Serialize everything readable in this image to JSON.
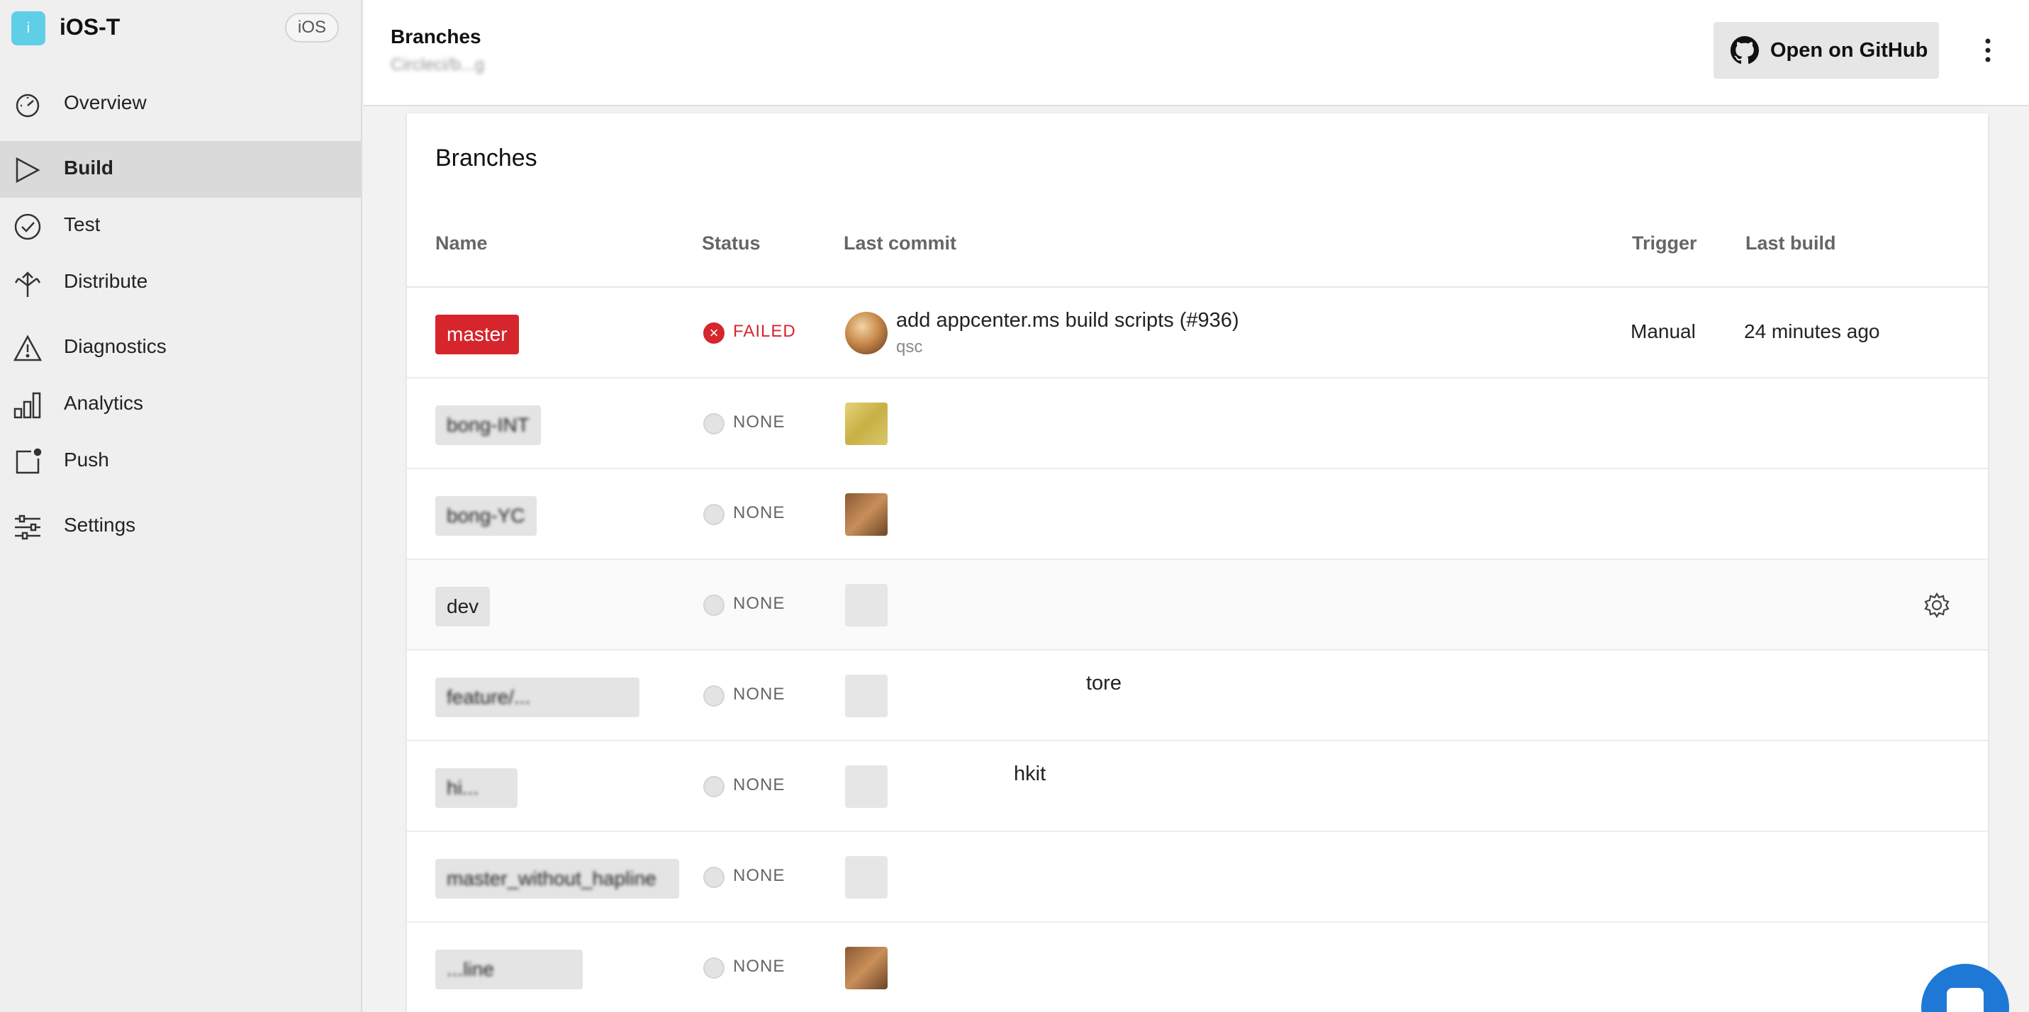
{
  "app": {
    "name": "iOS-T",
    "logo_letter": "i",
    "platform": "iOS",
    "accent_color": "#5fcfe8"
  },
  "sidebar": {
    "items": [
      {
        "label": "Overview",
        "icon": "gauge-icon"
      },
      {
        "label": "Build",
        "icon": "play-icon",
        "active": true
      },
      {
        "label": "Test",
        "icon": "check-circle-icon"
      },
      {
        "label": "Distribute",
        "icon": "distribute-arrows-icon"
      },
      {
        "label": "Diagnostics",
        "icon": "warning-triangle-icon"
      },
      {
        "label": "Analytics",
        "icon": "bar-chart-icon"
      },
      {
        "label": "Push",
        "icon": "push-notification-icon"
      },
      {
        "label": "Settings",
        "icon": "sliders-icon"
      }
    ]
  },
  "header": {
    "title": "Branches",
    "subtitle": "Circleci/b...g",
    "github_button_label": "Open on GitHub"
  },
  "card": {
    "title": "Branches",
    "columns": {
      "name": "Name",
      "status": "Status",
      "last_commit": "Last commit",
      "trigger": "Trigger",
      "last_build": "Last build"
    },
    "rows": [
      {
        "branch": "master",
        "status": "FAILED",
        "commit": "add appcenter.ms build scripts (#936)",
        "author": "qsc",
        "trigger": "Manual",
        "last_build": "24 minutes ago"
      },
      {
        "branch": "bong-INT",
        "status": "NONE",
        "commit": "",
        "author": "",
        "trigger": "",
        "last_build": ""
      },
      {
        "branch": "bong-YC",
        "status": "NONE",
        "commit": "",
        "author": "",
        "trigger": "",
        "last_build": ""
      },
      {
        "branch": "dev",
        "status": "NONE",
        "commit": "",
        "author": "",
        "trigger": "",
        "last_build": ""
      },
      {
        "branch": "feature/...",
        "status": "NONE",
        "commit": "tore",
        "author": "",
        "trigger": "",
        "last_build": ""
      },
      {
        "branch": "hi...",
        "status": "NONE",
        "commit": "hkit",
        "author": "",
        "trigger": "",
        "last_build": ""
      },
      {
        "branch": "master_without_hapline",
        "status": "NONE",
        "commit": "",
        "author": "",
        "trigger": "",
        "last_build": ""
      },
      {
        "branch": "...line",
        "status": "NONE",
        "commit": "",
        "author": "",
        "trigger": "",
        "last_build": ""
      }
    ]
  },
  "colors": {
    "failed": "#d6252d",
    "chat": "#1e79d6"
  }
}
